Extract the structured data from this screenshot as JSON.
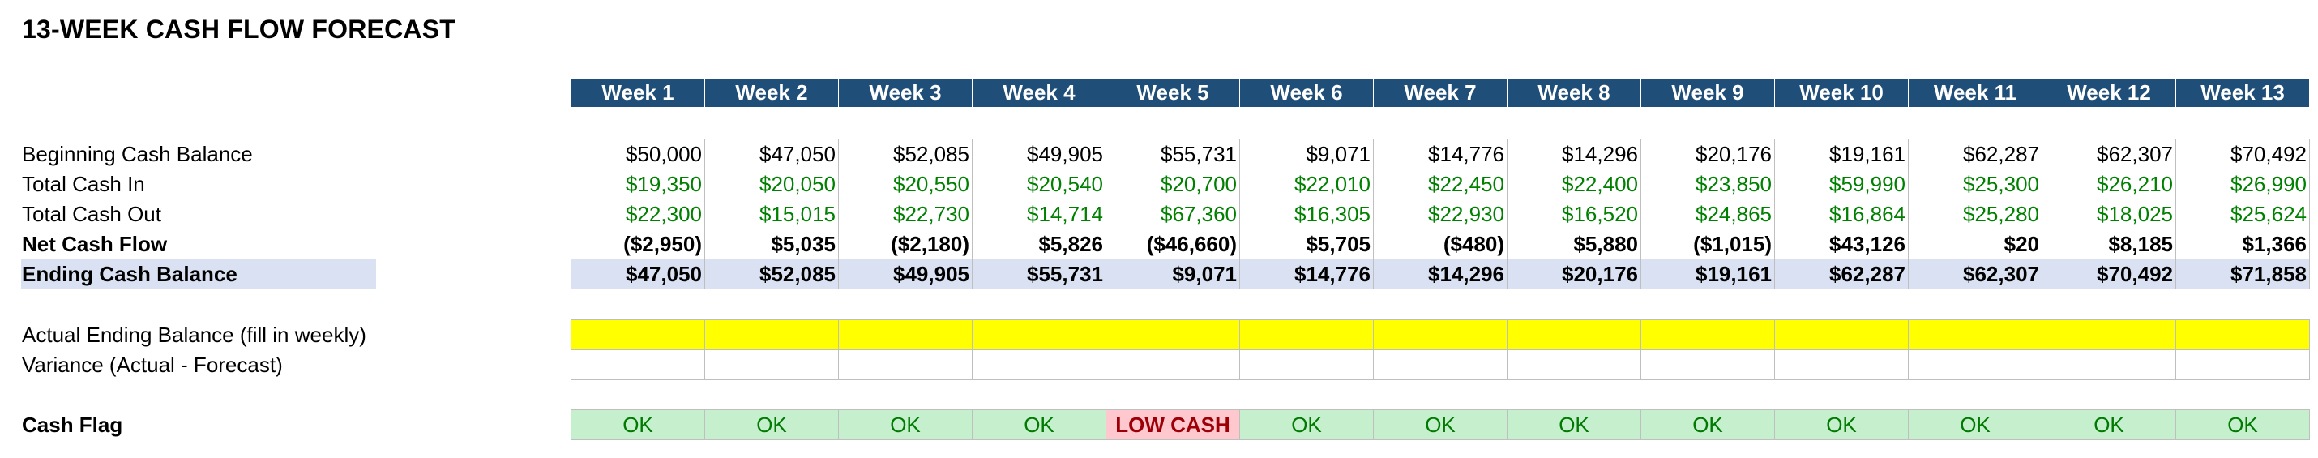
{
  "title": "13-WEEK CASH FLOW FORECAST",
  "weeks": [
    "Week 1",
    "Week 2",
    "Week 3",
    "Week 4",
    "Week 5",
    "Week 6",
    "Week 7",
    "Week 8",
    "Week 9",
    "Week 10",
    "Week 11",
    "Week 12",
    "Week 13"
  ],
  "labels": {
    "beginning": "Beginning Cash Balance",
    "cash_in": "Total Cash In",
    "cash_out": "Total Cash Out",
    "net": "Net Cash Flow",
    "ending": "Ending Cash Balance",
    "actual": "Actual Ending Balance (fill in weekly)",
    "variance": "Variance (Actual - Forecast)",
    "flag": "Cash Flag"
  },
  "rows": {
    "beginning": [
      "$50,000",
      "$47,050",
      "$52,085",
      "$49,905",
      "$55,731",
      "$9,071",
      "$14,776",
      "$14,296",
      "$20,176",
      "$19,161",
      "$62,287",
      "$62,307",
      "$70,492"
    ],
    "cash_in": [
      "$19,350",
      "$20,050",
      "$20,550",
      "$20,540",
      "$20,700",
      "$22,010",
      "$22,450",
      "$22,400",
      "$23,850",
      "$59,990",
      "$25,300",
      "$26,210",
      "$26,990"
    ],
    "cash_out": [
      "$22,300",
      "$15,015",
      "$22,730",
      "$14,714",
      "$67,360",
      "$16,305",
      "$22,930",
      "$16,520",
      "$24,865",
      "$16,864",
      "$25,280",
      "$18,025",
      "$25,624"
    ],
    "net": [
      "($2,950)",
      "$5,035",
      "($2,180)",
      "$5,826",
      "($46,660)",
      "$5,705",
      "($480)",
      "$5,880",
      "($1,015)",
      "$43,126",
      "$20",
      "$8,185",
      "$1,366"
    ],
    "ending": [
      "$47,050",
      "$52,085",
      "$49,905",
      "$55,731",
      "$9,071",
      "$14,776",
      "$14,296",
      "$20,176",
      "$19,161",
      "$62,287",
      "$62,307",
      "$70,492",
      "$71,858"
    ],
    "actual": [
      "",
      "",
      "",
      "",
      "",
      "",
      "",
      "",
      "",
      "",
      "",
      "",
      ""
    ],
    "variance": [
      "",
      "",
      "",
      "",
      "",
      "",
      "",
      "",
      "",
      "",
      "",
      "",
      ""
    ],
    "flag": [
      "OK",
      "OK",
      "OK",
      "OK",
      "LOW CASH",
      "OK",
      "OK",
      "OK",
      "OK",
      "OK",
      "OK",
      "OK",
      "OK"
    ]
  },
  "colors": {
    "header_bg": "#1f4e79",
    "input_green": "#008000",
    "ending_bg": "#d9e1f2",
    "actual_bg": "#ffff00",
    "ok_bg": "#c6efce",
    "low_bg": "#ffc7ce"
  }
}
